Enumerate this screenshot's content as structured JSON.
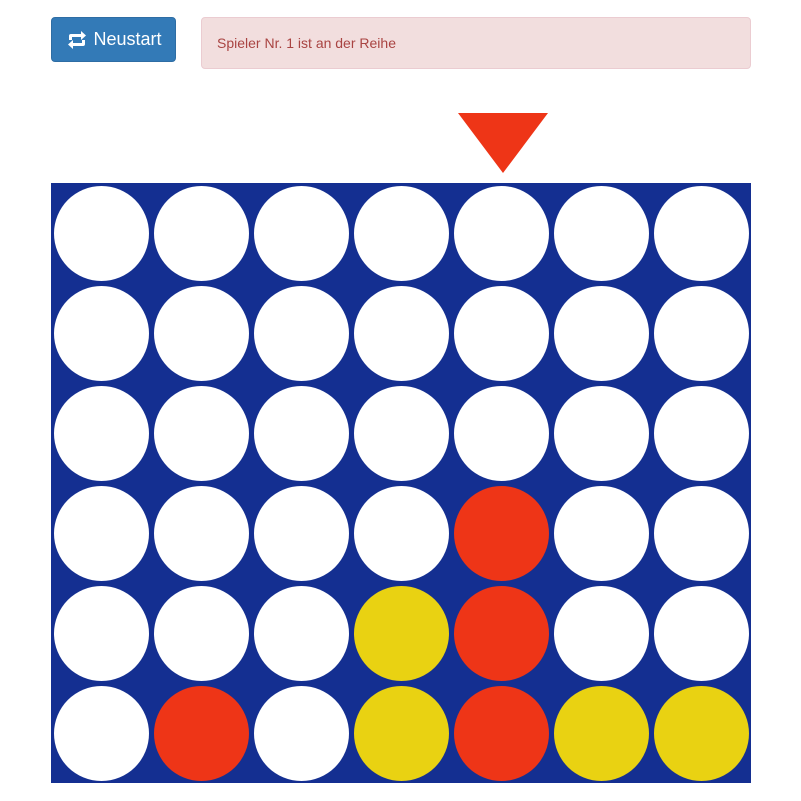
{
  "toolbar": {
    "restart_label": "Neustart",
    "restart_icon": "retweet-icon"
  },
  "status": {
    "message": "Spieler Nr. 1 ist an der Reihe"
  },
  "game": {
    "columns": 7,
    "rows": 6,
    "current_player": 1,
    "selected_column": 5,
    "indicator_color": "#ee3517",
    "board_color": "#142f91",
    "colors": {
      "empty": "#ffffff",
      "player1": "#ee3517",
      "player2": "#e9d212"
    },
    "grid": [
      [
        0,
        0,
        0,
        0,
        0,
        0,
        0
      ],
      [
        0,
        0,
        0,
        0,
        0,
        0,
        0
      ],
      [
        0,
        0,
        0,
        0,
        0,
        0,
        0
      ],
      [
        0,
        0,
        0,
        0,
        1,
        0,
        0
      ],
      [
        0,
        0,
        0,
        2,
        1,
        0,
        0
      ],
      [
        0,
        1,
        0,
        2,
        1,
        2,
        2
      ]
    ]
  }
}
